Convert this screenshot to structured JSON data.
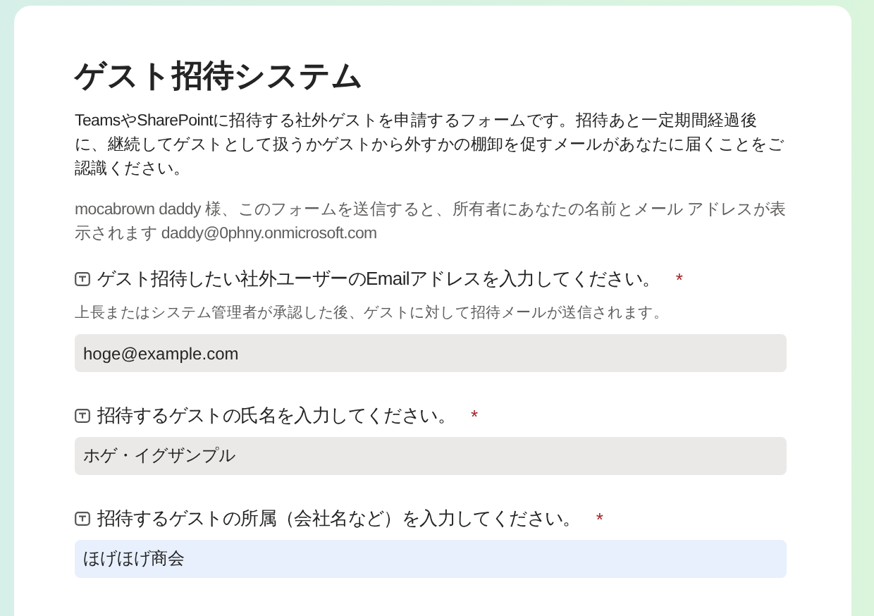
{
  "form": {
    "title": "ゲスト招待システム",
    "description": "TeamsやSharePointに招待する社外ゲストを申請するフォームです。招待あと一定期間経過後に、継続してゲストとして扱うかゲストから外すかの棚卸を促すメールがあなたに届くことをご認識ください。",
    "notice": "mocabrown daddy 様、このフォームを送信すると、所有者にあなたの名前とメール アドレスが表示されます daddy@0phny.onmicrosoft.com",
    "questions": [
      {
        "label": "ゲスト招待したい社外ユーザーのEmailアドレスを入力してください。",
        "required": true,
        "required_mark": "*",
        "hint": "上長またはシステム管理者が承認した後、ゲストに対して招待メールが送信されます。",
        "value": "hoge@example.com",
        "focused": false
      },
      {
        "label": "招待するゲストの氏名を入力してください。",
        "required": true,
        "required_mark": "*",
        "value": "ホゲ・イグザンプル",
        "focused": false
      },
      {
        "label": "招待するゲストの所属（会社名など）を入力してください。",
        "required": true,
        "required_mark": "*",
        "value": "ほげほげ商会",
        "focused": true
      }
    ]
  }
}
